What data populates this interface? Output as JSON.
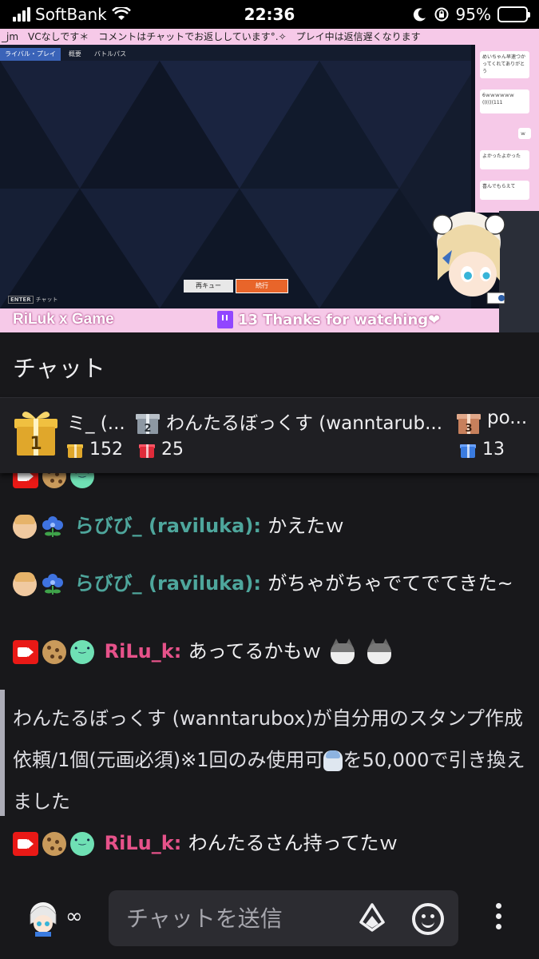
{
  "status_bar": {
    "carrier": "SoftBank",
    "time": "22:36",
    "battery_percent": "95%",
    "battery_level": 0.95
  },
  "stream": {
    "ticker": "_jm　VCなしです＊　コメントはチャットでお返ししています°.✧　プレイ中は返信遅くなります",
    "game_tabs": [
      "ライバル・プレイ",
      "概要",
      "バトルパス"
    ],
    "game_btn_left": "再キュー",
    "game_btn_right": "続行",
    "game_chat_key": "ENTER",
    "game_chat_label": "チャット",
    "overlay_title": "RiLuk x Game",
    "viewer_count": "13",
    "thanks_text": "Thanks for watching❤",
    "overlay_bubbles": [
      "めいちゃん早速つかってくれてありがとう",
      "6ｗｗｗｗｗｗ((((((111",
      "ｗ",
      "よかったよかった",
      "喜んでもらえて"
    ]
  },
  "chat": {
    "title": "チャット",
    "leaderboard": [
      {
        "rank": "1",
        "name": "ミ_ (...",
        "count": "152",
        "color": "#e0a72b"
      },
      {
        "rank": "2",
        "name": "わんたるぼっくす (wanntarub...",
        "count": "25",
        "color": "#e02b3a"
      },
      {
        "rank": "3",
        "name": "po...",
        "count": "13",
        "color": "#3a7be0"
      }
    ],
    "messages": [
      {
        "user": "らびび_ (raviluka)",
        "text": "かえたｗ"
      },
      {
        "user": "らびび_ (raviluka)",
        "text": "がちゃがちゃでてでてきた~"
      },
      {
        "user": "RiLu_k",
        "text": "あってるかもｗ"
      },
      {
        "user": "RiLu_k",
        "text": "わんたるさん持ってたｗ"
      }
    ],
    "redemption": {
      "before": "わんたるぼっくす (wanntarubox)が自分用のスタンプ作成依頼/1個(元画必須)※1回のみ使用可",
      "after": "を50,000で引き換えました"
    },
    "input_placeholder": "チャットを送信",
    "infinity": "∞"
  },
  "colors": {
    "accent_pink": "#f6c9e8",
    "twitch_purple": "#9146ff",
    "mod_red": "#e91916",
    "name_teal": "#4ea69c",
    "name_pink": "#e6528a"
  }
}
